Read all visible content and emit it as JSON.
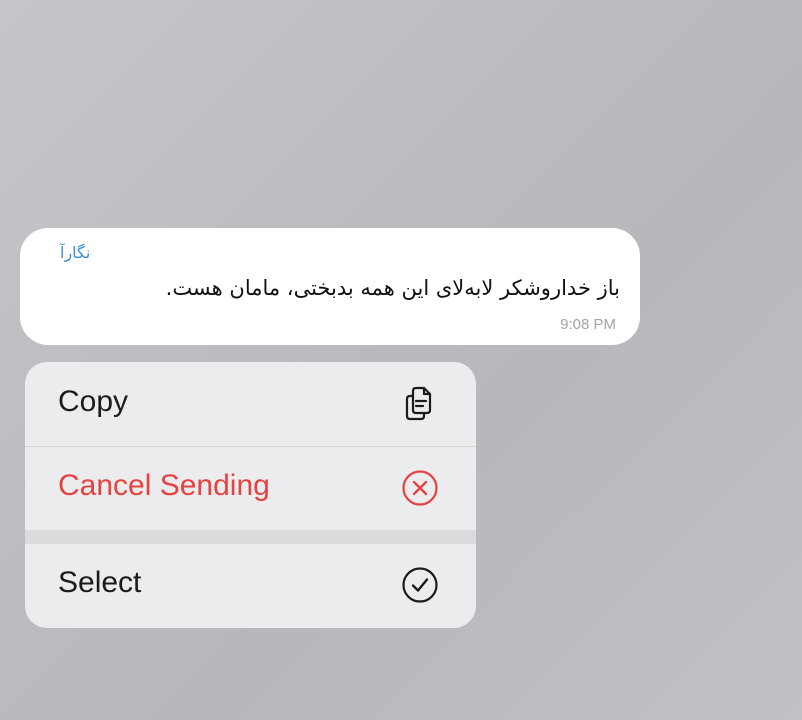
{
  "message": {
    "sender": "نگارآ",
    "text": "باز خداروشکر لابه‌لای این همه بدبختی، مامان هست.",
    "time": "9:08 PM"
  },
  "menu": {
    "items": [
      {
        "label": "Copy",
        "icon": "copy-icon",
        "color": "#1b1b1d"
      },
      {
        "label": "Cancel Sending",
        "icon": "x-circle-icon",
        "color": "#e5433f"
      },
      {
        "label": "Select",
        "icon": "checkmark-circle-icon",
        "color": "#1b1b1d"
      }
    ]
  },
  "colors": {
    "sender_name": "#3b8fd0",
    "destructive": "#e5433f",
    "menu_background": "#ececef",
    "bubble_background": "#ffffff"
  }
}
